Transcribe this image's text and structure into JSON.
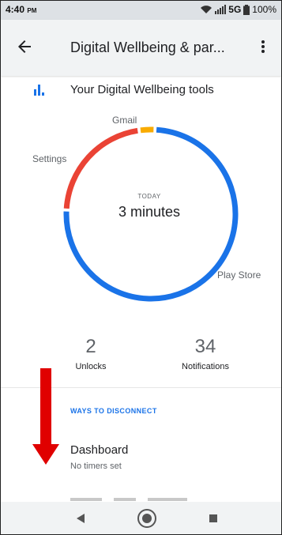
{
  "status_bar": {
    "time": "4:40",
    "ampm": "PM",
    "network": "5G",
    "battery": "100%"
  },
  "app_bar": {
    "title": "Digital Wellbeing & par..."
  },
  "section": {
    "title": "Your Digital Wellbeing tools"
  },
  "usage": {
    "period_label": "TODAY",
    "total": "3 minutes",
    "apps": [
      {
        "name": "Gmail",
        "color": "#f9ab00",
        "share": 0.03
      },
      {
        "name": "Settings",
        "color": "#ea4335",
        "share": 0.22
      },
      {
        "name": "Play Store",
        "color": "#1a73e8",
        "share": 0.75
      }
    ]
  },
  "stats": {
    "unlocks_count": "2",
    "unlocks_label": "Unlocks",
    "notifications_count": "34",
    "notifications_label": "Notifications"
  },
  "ways": {
    "header": "WAYS TO DISCONNECT",
    "dashboard_title": "Dashboard",
    "dashboard_subtitle": "No timers set"
  },
  "colors": {
    "accent": "#1a73e8",
    "annotation_arrow": "#e00000"
  },
  "icons": [
    "back-arrow-icon",
    "more-vert-icon",
    "bar-chart-icon",
    "wifi-icon",
    "signal-icon",
    "battery-icon",
    "nav-back-icon",
    "nav-home-icon",
    "nav-recents-icon"
  ]
}
